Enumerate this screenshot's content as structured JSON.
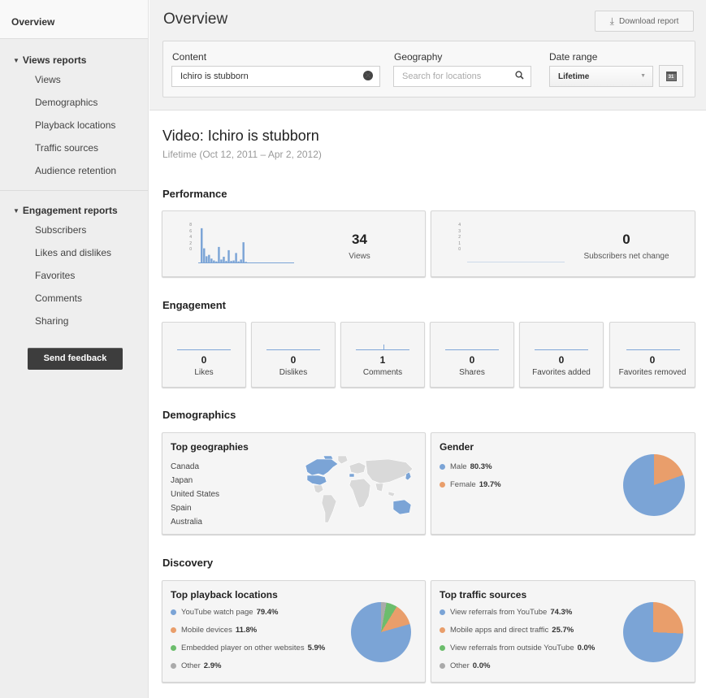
{
  "sidebar": {
    "overview": "Overview",
    "views_reports": {
      "title": "Views reports",
      "items": [
        "Views",
        "Demographics",
        "Playback locations",
        "Traffic sources",
        "Audience retention"
      ]
    },
    "engagement_reports": {
      "title": "Engagement reports",
      "items": [
        "Subscribers",
        "Likes and dislikes",
        "Favorites",
        "Comments",
        "Sharing"
      ]
    },
    "feedback_label": "Send feedback"
  },
  "header": {
    "title": "Overview",
    "download_label": "Download report",
    "filters": {
      "content_label": "Content",
      "content_value": "Ichiro is stubborn",
      "geography_label": "Geography",
      "geography_placeholder": "Search for locations",
      "date_label": "Date range",
      "date_value": "Lifetime",
      "calendar_day": "31"
    }
  },
  "video": {
    "title": "Video: Ichiro is stubborn",
    "subtitle": "Lifetime (Oct 12, 2011 – Apr 2, 2012)"
  },
  "performance": {
    "heading": "Performance",
    "views": {
      "value": "34",
      "label": "Views",
      "axis_ticks": [
        "8",
        "6",
        "4",
        "2",
        "0"
      ],
      "sparkline": [
        0,
        7.5,
        3.2,
        1.5,
        1.8,
        1.0,
        0.6,
        0.4,
        3.5,
        0.8,
        1.4,
        0.5,
        2.8,
        0.5,
        0.6,
        2.2,
        0.4,
        0.8,
        4.5,
        0.3,
        0,
        0,
        0,
        0,
        0,
        0,
        0,
        0,
        0,
        0,
        0,
        0,
        0,
        0,
        0,
        0,
        0,
        0,
        0
      ]
    },
    "subscribers": {
      "value": "0",
      "label": "Subscribers net change",
      "axis_ticks": [
        "4",
        "3",
        "2",
        "1",
        "0"
      ]
    }
  },
  "engagement": {
    "heading": "Engagement",
    "items": [
      {
        "value": "0",
        "label": "Likes"
      },
      {
        "value": "0",
        "label": "Dislikes"
      },
      {
        "value": "1",
        "label": "Comments"
      },
      {
        "value": "0",
        "label": "Shares"
      },
      {
        "value": "0",
        "label": "Favorites added"
      },
      {
        "value": "0",
        "label": "Favorites removed"
      }
    ]
  },
  "demographics": {
    "heading": "Demographics",
    "geographies": {
      "title": "Top geographies",
      "items": [
        "Canada",
        "Japan",
        "United States",
        "Spain",
        "Australia"
      ]
    },
    "gender": {
      "title": "Gender",
      "items": [
        {
          "label": "Male",
          "value": "80.3%",
          "color": "#7ba4d6",
          "share": 80.3
        },
        {
          "label": "Female",
          "value": "19.7%",
          "color": "#e99e6b",
          "share": 19.7
        }
      ]
    }
  },
  "discovery": {
    "heading": "Discovery",
    "playback": {
      "title": "Top playback locations",
      "items": [
        {
          "label": "YouTube watch page",
          "value": "79.4%",
          "color": "#7ba4d6",
          "share": 79.4
        },
        {
          "label": "Mobile devices",
          "value": "11.8%",
          "color": "#e99e6b",
          "share": 11.8
        },
        {
          "label": "Embedded player on other websites",
          "value": "5.9%",
          "color": "#6cbd6c",
          "share": 5.9
        },
        {
          "label": "Other",
          "value": "2.9%",
          "color": "#aaaaaa",
          "share": 2.9
        }
      ]
    },
    "traffic": {
      "title": "Top traffic sources",
      "items": [
        {
          "label": "View referrals from YouTube",
          "value": "74.3%",
          "color": "#7ba4d6",
          "share": 74.3
        },
        {
          "label": "Mobile apps and direct traffic",
          "value": "25.7%",
          "color": "#e99e6b",
          "share": 25.7
        },
        {
          "label": "View referrals from outside YouTube",
          "value": "0.0%",
          "color": "#6cbd6c",
          "share": 0.0
        },
        {
          "label": "Other",
          "value": "0.0%",
          "color": "#aaaaaa",
          "share": 0.0
        }
      ]
    }
  }
}
